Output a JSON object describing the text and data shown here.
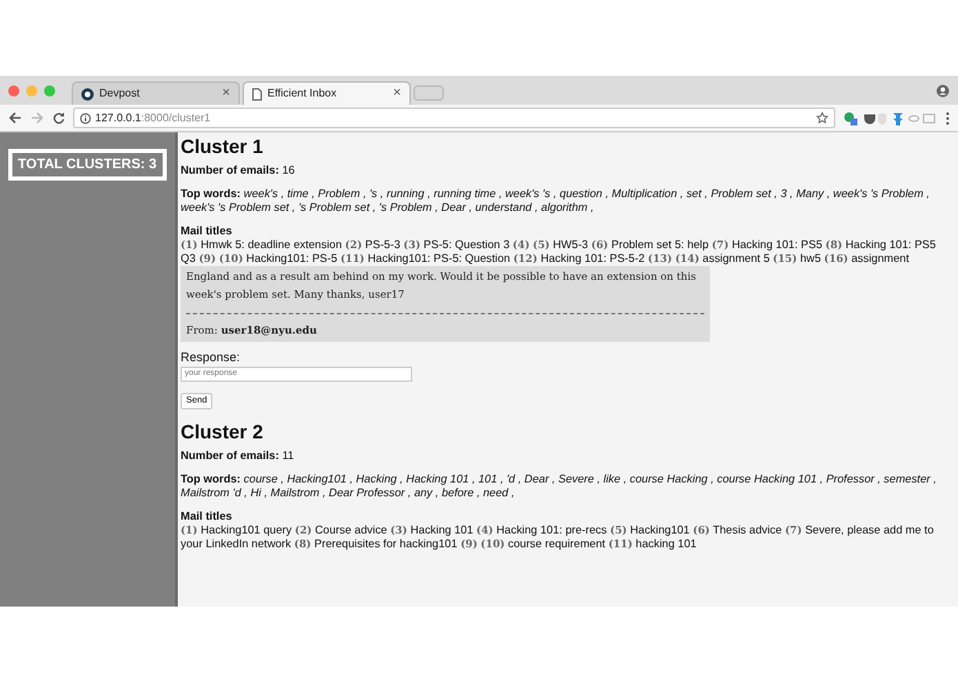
{
  "browser": {
    "tabs": [
      {
        "title": "Devpost",
        "selected": false
      },
      {
        "title": "Efficient Inbox",
        "selected": true
      }
    ],
    "close_glyph": "×",
    "url_host": "127.0.0.1",
    "url_path": ":8000/cluster1"
  },
  "sidebar": {
    "total_clusters": "TOTAL CLUSTERS: 3"
  },
  "clusters": [
    {
      "heading": "Cluster 1",
      "emails_label": "Number of emails:",
      "emails_count": "16",
      "top_words_label": "Top words:",
      "top_words": "week's , time , Problem , 's , running , running time , week's 's , question , Multiplication , set , Problem set , 3 , Many , week's 's Problem , week's 's Problem set , 's Problem set , 's Problem , Dear , understand , algorithm ,",
      "mail_titles_label": "Mail titles",
      "mail_titles": [
        {
          "number": "(1)",
          "title": "Hmwk 5: deadline extension"
        },
        {
          "number": "(2)",
          "title": "PS-5-3"
        },
        {
          "number": "(3)",
          "title": "PS-5: Question 3"
        },
        {
          "number": "(4)"
        },
        {
          "number": "(5)",
          "title": "HW5-3"
        },
        {
          "number": "(6)",
          "title": "Problem set 5: help"
        },
        {
          "number": "(7)",
          "title": "Hacking 101: PS5"
        },
        {
          "number": "(8)",
          "title": "Hacking 101: PS5 Q3"
        },
        {
          "number": "(9)"
        },
        {
          "number": "(10)",
          "title": "Hacking101: PS-5"
        },
        {
          "number": "(11)",
          "title": "Hacking101: PS-5: Question"
        },
        {
          "number": "(12)",
          "title": "Hacking 101: PS-5-2"
        },
        {
          "number": "(13)"
        },
        {
          "number": "(14)",
          "title": "assignment 5"
        },
        {
          "number": "(15)",
          "title": "hw5"
        },
        {
          "number": "(16)",
          "title": "assignment"
        }
      ],
      "preview": {
        "body": "England and as a result am behind on my work. Would it be possible to have an extension on this week's problem set. Many thanks, user17",
        "from_label": "From:",
        "from": "user18@nyu.edu"
      },
      "response": {
        "label": "Response:",
        "placeholder": "your response",
        "button": "Send"
      }
    },
    {
      "heading": "Cluster 2",
      "emails_label": "Number of emails:",
      "emails_count": "11",
      "top_words_label": "Top words:",
      "top_words": "course , Hacking101 , Hacking , Hacking 101 , 101 , 'd , Dear , Severe , like , course Hacking , course Hacking 101 , Professor , semester , Mailstrom 'd , Hi , Mailstrom , Dear Professor , any , before , need ,",
      "mail_titles_label": "Mail titles",
      "mail_titles": [
        {
          "number": "(1)",
          "title": "Hacking101 query"
        },
        {
          "number": "(2)",
          "title": "Course advice"
        },
        {
          "number": "(3)",
          "title": "Hacking 101"
        },
        {
          "number": "(4)",
          "title": "Hacking 101: pre-recs"
        },
        {
          "number": "(5)",
          "title": "Hacking101"
        },
        {
          "number": "(6)",
          "title": "Thesis advice"
        },
        {
          "number": "(7)",
          "title": "Severe, please add me to your LinkedIn network"
        },
        {
          "number": "(8)",
          "title": "Prerequisites for hacking101"
        },
        {
          "number": "(9)"
        },
        {
          "number": "(10)",
          "title": "course requirement"
        },
        {
          "number": "(11)",
          "title": "hacking 101"
        }
      ]
    }
  ]
}
